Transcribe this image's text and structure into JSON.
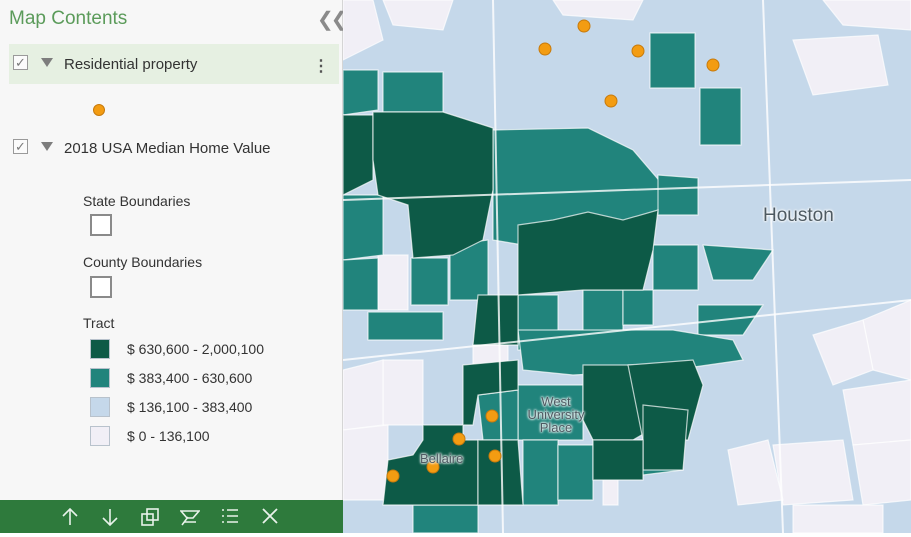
{
  "panel": {
    "title": "Map Contents",
    "layers": [
      {
        "label": "Residential property",
        "checked": true,
        "expanded": true,
        "symbol": "orange-dot",
        "symbol_color": "#f39c12"
      },
      {
        "label": "2018 USA Median Home Value",
        "checked": true,
        "expanded": true
      }
    ],
    "sublayers": [
      {
        "label": "State Boundaries",
        "checked": false
      },
      {
        "label": "County Boundaries",
        "checked": false
      }
    ],
    "legend": {
      "title": "Tract",
      "classes": [
        {
          "label": "$ 630,600 - 2,000,100",
          "color": "#0d5a47"
        },
        {
          "label": "$ 383,400 - 630,600",
          "color": "#21847c"
        },
        {
          "label": "$ 136,100 - 383,400",
          "color": "#c5d8ea"
        },
        {
          "label": "$ 0 - 136,100",
          "color": "#f1eff6"
        }
      ]
    }
  },
  "toolbar": {
    "buttons": [
      "move-up-icon",
      "move-down-icon",
      "zoom-to-layer-icon",
      "remove-layer-icon",
      "legend-list-icon",
      "close-icon"
    ]
  },
  "map": {
    "place_labels": [
      "Houston",
      "West\nUniversity\nPlace",
      "Bellaire"
    ],
    "point_color": "#f39c12"
  }
}
